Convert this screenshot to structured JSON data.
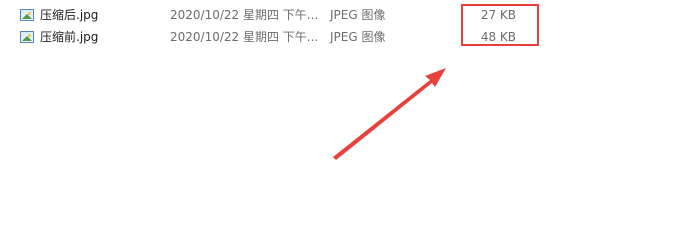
{
  "files": [
    {
      "name": "压缩后.jpg",
      "date_modified": "2020/10/22 星期四 下午...",
      "type": "JPEG 图像",
      "size": "27 KB",
      "icon": "image-file-icon"
    },
    {
      "name": "压缩前.jpg",
      "date_modified": "2020/10/22 星期四 下午...",
      "type": "JPEG 图像",
      "size": "48 KB",
      "icon": "image-file-icon"
    }
  ],
  "annotation": {
    "highlight_color": "#e8403c",
    "arrow_color": "#e8403c"
  }
}
